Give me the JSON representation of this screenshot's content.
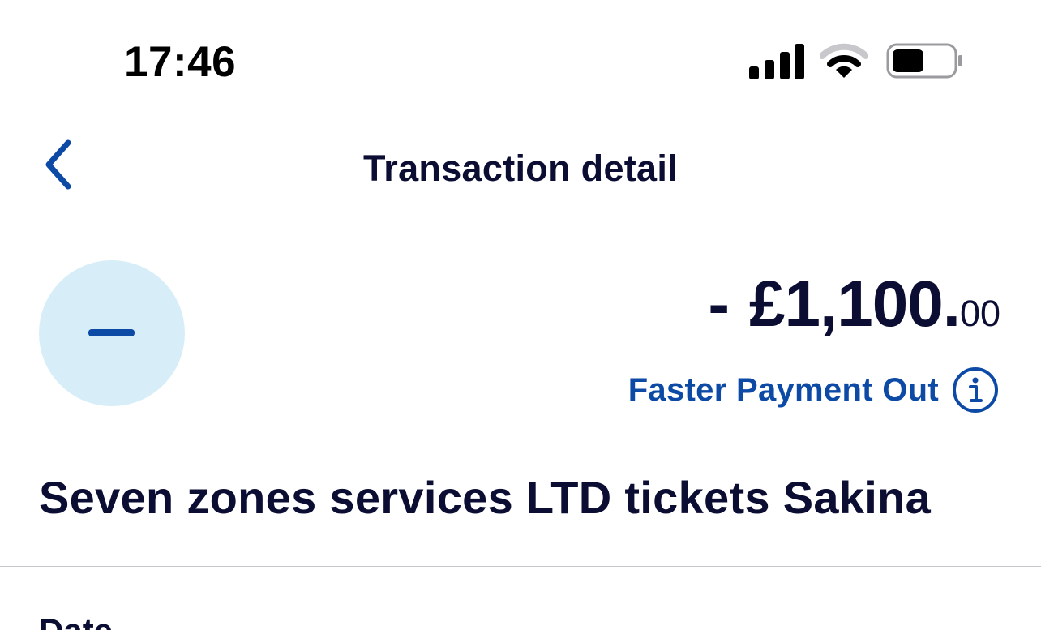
{
  "status_bar": {
    "time": "17:46",
    "icons": [
      "cellular-signal-icon",
      "wifi-icon",
      "battery-icon"
    ]
  },
  "header": {
    "back_icon": "chevron-left-icon",
    "title": "Transaction detail"
  },
  "transaction": {
    "direction_icon": "minus-icon",
    "amount_sign": "-",
    "amount_major": "£1,100.",
    "amount_minor": "00",
    "type": "Faster Payment Out",
    "type_info_icon": "info-circle-icon",
    "description": "Seven zones services LTD tickets Sakina"
  },
  "details": {
    "date_label": "Date"
  },
  "colors": {
    "text_primary": "#0b0d33",
    "accent_blue": "#0d4aa6",
    "avatar_background": "#d7eef8",
    "divider": "#8e8e93"
  }
}
